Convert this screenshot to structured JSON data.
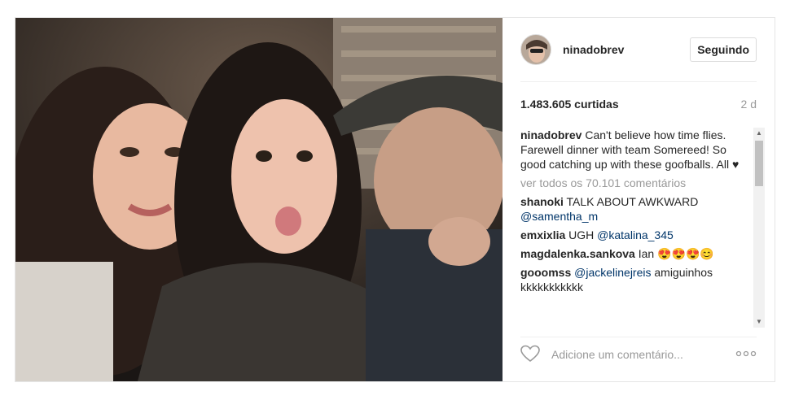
{
  "post": {
    "username": "ninadobrev",
    "follow_label": "Seguindo",
    "likes": "1.483.605 curtidas",
    "time_ago": "2 d",
    "caption": {
      "author": "ninadobrev",
      "text": "Can't believe how time flies. Farewell dinner with team Somereed! So good catching up with these goofballs. All ♥"
    },
    "view_all": "ver todos os 70.101 comentários",
    "comments": [
      {
        "author": "shanoki",
        "text": "TALK ABOUT AWKWARD",
        "mention": "@samentha_m"
      },
      {
        "author": "emxixlia",
        "text": "UGH",
        "mention": "@katalina_345"
      },
      {
        "author": "magdalenka.sankova",
        "text": "Ian 😍😍😍😊",
        "mention": ""
      },
      {
        "author": "gooomss",
        "mention": "@jackelinejreis",
        "text": "amiguinhos kkkkkkkkkkk"
      }
    ],
    "add_comment_placeholder": "Adicione um comentário...",
    "icons": {
      "heart": "heart-outline-icon",
      "more": "more-options-icon",
      "scroll_up": "▲",
      "scroll_down": "▼",
      "more_glyph": "ooo"
    }
  },
  "colors": {
    "mention": "#003569",
    "muted": "#999999",
    "border": "#e6e6e6"
  }
}
